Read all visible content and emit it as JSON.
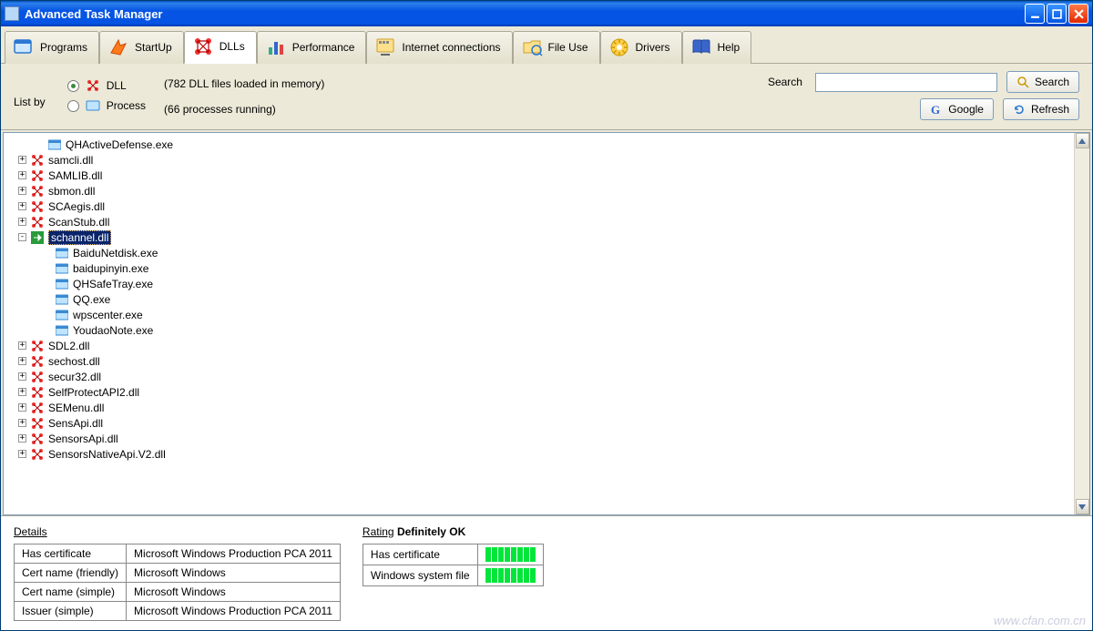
{
  "window": {
    "title": "Advanced Task Manager"
  },
  "tabs": [
    {
      "label": "Programs"
    },
    {
      "label": "StartUp"
    },
    {
      "label": "DLLs"
    },
    {
      "label": "Performance"
    },
    {
      "label": "Internet connections"
    },
    {
      "label": "File Use"
    },
    {
      "label": "Drivers"
    },
    {
      "label": "Help"
    }
  ],
  "filter": {
    "listby_label": "List by",
    "radio_dll_label": "DLL",
    "radio_process_label": "Process",
    "summary_dll": "(782 DLL files loaded in memory)",
    "summary_process": "(66 processes running)",
    "search_label": "Search",
    "search_value": "",
    "btn_search": "Search",
    "btn_google": "Google",
    "btn_refresh": "Refresh"
  },
  "tree": {
    "top_child": "QHActiveDefense.exe",
    "dlls_before": [
      "samcli.dll",
      "SAMLIB.dll",
      "sbmon.dll",
      "SCAegis.dll",
      "ScanStub.dll"
    ],
    "selected": "schannel.dll",
    "selected_children": [
      "BaiduNetdisk.exe",
      "baidupinyin.exe",
      "QHSafeTray.exe",
      "QQ.exe",
      "wpscenter.exe",
      "YoudaoNote.exe"
    ],
    "dlls_after": [
      "SDL2.dll",
      "sechost.dll",
      "secur32.dll",
      "SelfProtectAPI2.dll",
      "SEMenu.dll",
      "SensApi.dll",
      "SensorsApi.dll",
      "SensorsNativeApi.V2.dll"
    ]
  },
  "details": {
    "header": "Details",
    "rows": [
      {
        "k": "Has certificate",
        "v": "Microsoft Windows Production PCA 2011"
      },
      {
        "k": "Cert name (friendly)",
        "v": "Microsoft Windows"
      },
      {
        "k": "Cert name (simple)",
        "v": "Microsoft Windows"
      },
      {
        "k": "Issuer (simple)",
        "v": "Microsoft Windows Production PCA 2011"
      }
    ]
  },
  "rating": {
    "label": "Rating",
    "value": "Definitely OK",
    "rows": [
      {
        "k": "Has certificate"
      },
      {
        "k": "Windows system file"
      }
    ]
  },
  "watermark": "www.cfan.com.cn"
}
